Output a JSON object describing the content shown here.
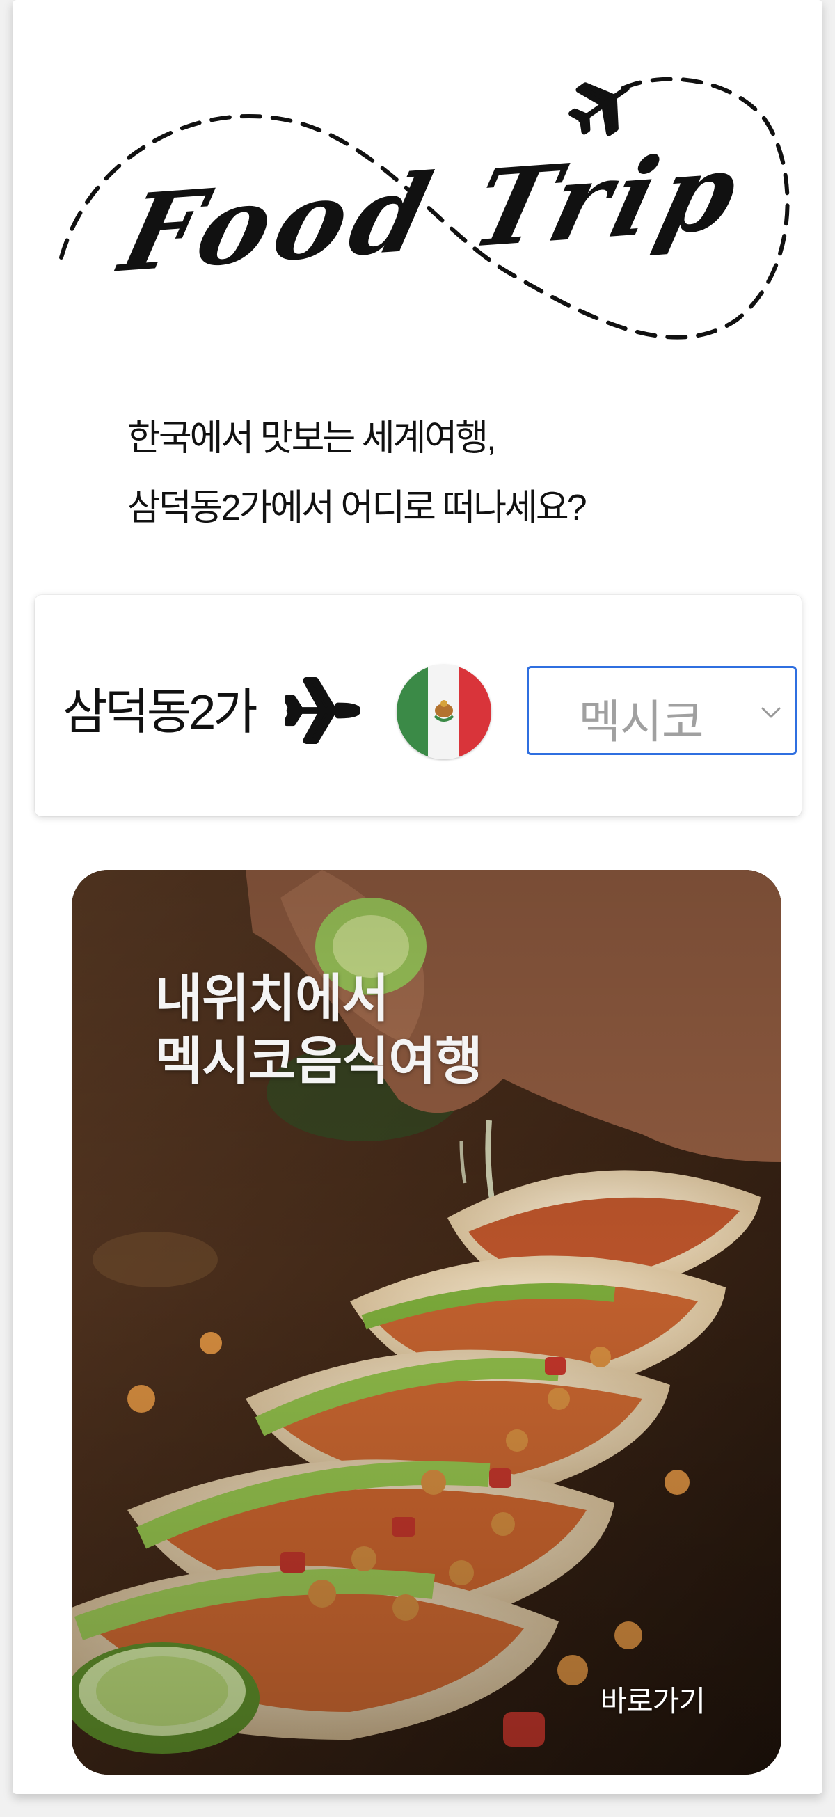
{
  "logo": {
    "text": "Food Trip",
    "icon": "airplane-icon"
  },
  "headline": {
    "line1": "한국에서 맛보는 세계여행,",
    "line2": "삼덕동2가에서 어디로 떠나세요?"
  },
  "route": {
    "origin": "삼덕동2가",
    "plane_icon": "airplane-icon",
    "flag_icon": "mexico-flag-icon",
    "destination": "멕시코",
    "select_icon": "chevron-down-icon",
    "accent_color": "#2f6fe0"
  },
  "promo": {
    "title_line1": "내위치에서",
    "title_line2": "멕시코음식여행",
    "link_label": "바로가기",
    "image": "tacos-photo"
  }
}
